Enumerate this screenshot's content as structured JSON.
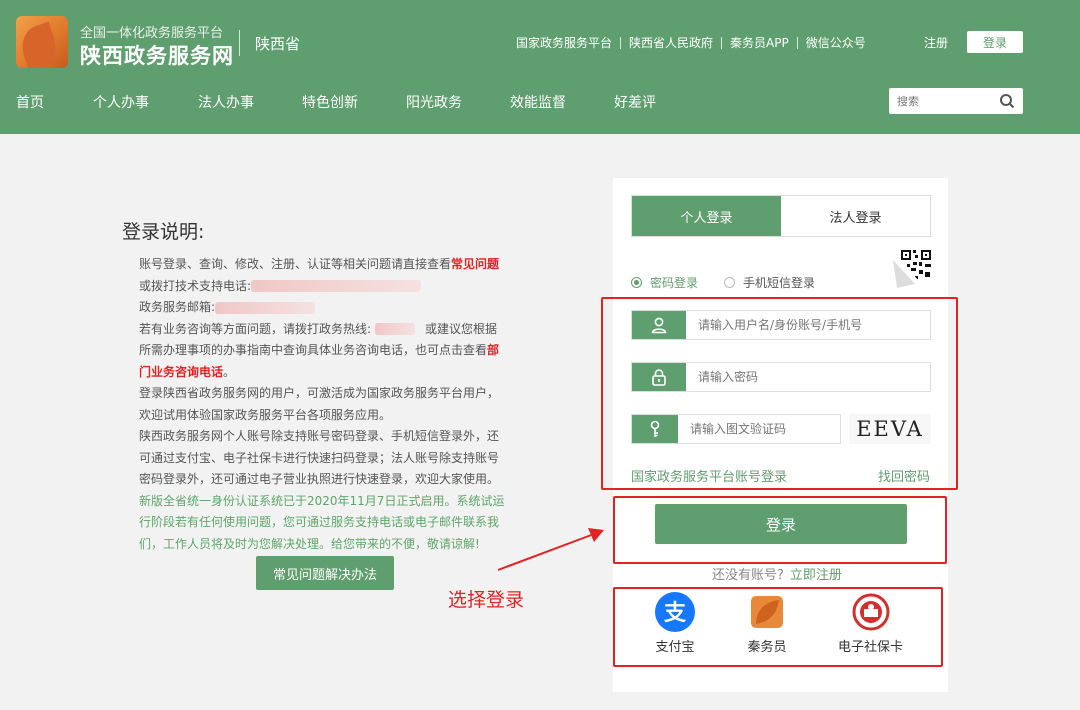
{
  "header": {
    "logo_sub": "全国一体化政务服务平台",
    "logo_title": "陕西政务服务网",
    "province": "陕西省",
    "top_links": [
      "国家政务服务平台",
      "陕西省人民政府",
      "秦务员APP",
      "微信公众号"
    ],
    "register": "注册",
    "login": "登录",
    "nav": [
      "首页",
      "个人办事",
      "法人办事",
      "特色创新",
      "阳光政务",
      "效能监督",
      "好差评"
    ],
    "search_placeholder": "搜索"
  },
  "info": {
    "title": "登录说明:",
    "p1_a": "账号登录、查询、修改、注册、认证等相关问题请直接查看",
    "p1_link": "常见问题",
    "p1_b": "或拨打技术支持电话:",
    "p2": "政务服务邮箱:",
    "p3_a": "若有业务咨询等方面问题，请拨打政务热线:",
    "p3_b": "或建议您根据所需办理事项的办事指南中查询具体业务咨询电话，也可点击查看",
    "p3_link": "部门业务咨询电话",
    "p3_end": "。",
    "p4": "登录陕西省政务服务网的用户，可激活成为国家政务服务平台用户，欢迎试用体验国家政务服务平台各项服务应用。",
    "p5": "陕西政务服务网个人账号除支持账号密码登录、手机短信登录外，还可通过支付宝、电子社保卡进行快速扫码登录；法人账号除支持账号密码登录外，还可通过电子营业执照进行快速登录，欢迎大家使用。",
    "p6": "新版全省统一身份认证系统已于2020年11月7日正式启用。系统试运行阶段若有任何使用问题，您可通过服务支持电话或电子邮件联系我们，工作人员将及时为您解决处理。给您带来的不便，敬请谅解!",
    "faq_button": "常见问题解决办法"
  },
  "annotation": {
    "label": "选择登录"
  },
  "login_card": {
    "tabs": [
      "个人登录",
      "法人登录"
    ],
    "radios": [
      "密码登录",
      "手机短信登录"
    ],
    "username_placeholder": "请输入用户名/身份账号/手机号",
    "password_placeholder": "请输入密码",
    "captcha_placeholder": "请输入图文验证码",
    "captcha_text": "EEVA",
    "gov_link": "国家政务服务平台账号登录",
    "find_password": "找回密码",
    "login_button": "登录",
    "no_account": "还没有账号?",
    "register_now": "立即注册",
    "alt_logins": [
      "支付宝",
      "秦务员",
      "电子社保卡"
    ]
  },
  "colors": {
    "brand_green": "#5f9e6e",
    "annotation_red": "#e02424",
    "alipay_blue": "#1677ff"
  }
}
